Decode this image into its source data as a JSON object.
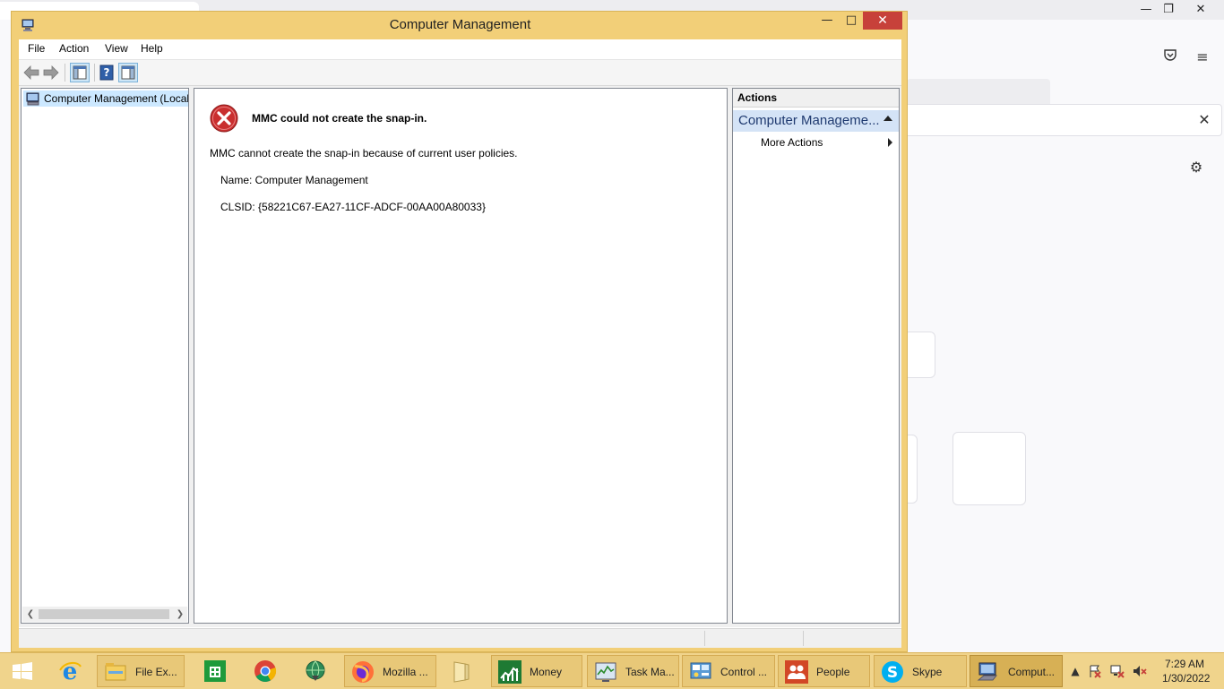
{
  "window": {
    "title": "Computer Management",
    "controls": {
      "minimize": "—",
      "maximize": "□",
      "close": "✕"
    }
  },
  "menubar": [
    "File",
    "Action",
    "View",
    "Help"
  ],
  "tree": {
    "root_label": "Computer Management (Local"
  },
  "error": {
    "title": "MMC could not create the snap-in.",
    "description": "MMC cannot create the snap-in because of current user policies.",
    "name_line": "Name: Computer Management",
    "clsid_line": "CLSID: {58221C67-EA27-11CF-ADCF-00AA00A80033}"
  },
  "actions": {
    "header": "Actions",
    "section": "Computer Manageme...",
    "items": [
      "More Actions"
    ]
  },
  "taskbar": {
    "items": [
      {
        "label": "",
        "icon": "internet-explorer-icon"
      },
      {
        "label": "File Ex...",
        "icon": "file-explorer-icon"
      },
      {
        "label": "",
        "icon": "store-icon"
      },
      {
        "label": "",
        "icon": "chrome-icon"
      },
      {
        "label": "",
        "icon": "globe-download-icon"
      },
      {
        "label": "Mozilla ...",
        "icon": "firefox-icon"
      },
      {
        "label": "",
        "icon": "folder-icon"
      },
      {
        "label": "Money",
        "icon": "money-icon"
      },
      {
        "label": "Task Ma...",
        "icon": "task-manager-icon"
      },
      {
        "label": "Control ...",
        "icon": "control-panel-icon"
      },
      {
        "label": "People",
        "icon": "people-icon"
      },
      {
        "label": "Skype",
        "icon": "skype-icon"
      },
      {
        "label": "Comput...",
        "icon": "computer-management-icon"
      }
    ],
    "clock": {
      "time": "7:29 AM",
      "date": "1/30/2022"
    }
  },
  "colors": {
    "window_frame": "#f2cf78",
    "close_button": "#c7413a",
    "taskbar": "#f0d48c",
    "selection": "#cce8ff",
    "action_section": "#d4e3f6"
  }
}
